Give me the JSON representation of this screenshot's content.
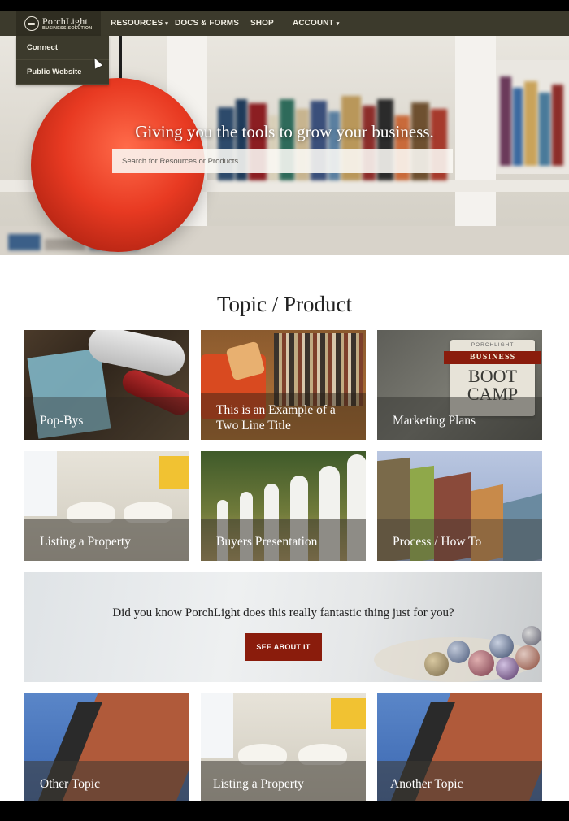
{
  "nav": {
    "logo_name": "PorchLight",
    "logo_sub": "BUSINESS SOLUTION",
    "items": [
      {
        "label": "RESOURCES",
        "caret": "▾"
      },
      {
        "label": "DOCS & FORMS",
        "caret": ""
      },
      {
        "label": "SHOP",
        "caret": ""
      },
      {
        "label": "ACCOUNT",
        "caret": "▾"
      }
    ],
    "dropdown": [
      "Connect",
      "Public Website"
    ]
  },
  "hero": {
    "title": "Giving you the tools to grow your business.",
    "search_placeholder": "Search for Resources or Products"
  },
  "section_title": "Topic / Product",
  "tiles": [
    {
      "label": "Pop-Bys",
      "image": "spotlight-cans"
    },
    {
      "label": "This is an Example of a Two Line Title",
      "image": "bookshelf-orange-chair"
    },
    {
      "label": "Marketing Plans",
      "image": "boot-camp-badge",
      "badge_top": "PORCHLIGHT",
      "badge_mid": "BUSINESS",
      "badge_bottom": "BOOT CAMP"
    },
    {
      "label": "Listing a Property",
      "image": "white-chairs"
    },
    {
      "label": "Buyers Presentation",
      "image": "picket-fence"
    },
    {
      "label": "Process / How To",
      "image": "townhouses"
    },
    {
      "label": "Other Topic",
      "image": "brick-building"
    },
    {
      "label": "Listing a Property",
      "image": "white-chairs"
    },
    {
      "label": "Another Topic",
      "image": "brick-building"
    }
  ],
  "promo": {
    "text": "Did you know PorchLight does this really fantastic thing just for you?",
    "button_label": "SEE ABOUT IT"
  },
  "colors": {
    "nav_bg": "#3c3a2c",
    "button_red": "#8a1c0c",
    "lamp_red": "#e83a22"
  }
}
